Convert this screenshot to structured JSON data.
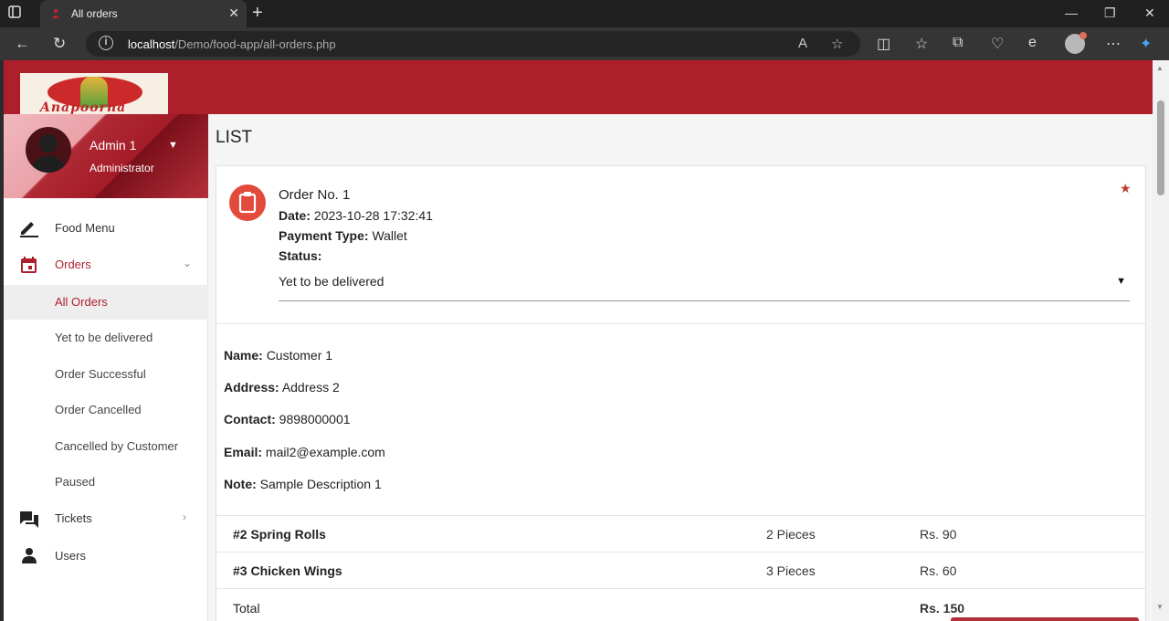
{
  "browser": {
    "tab_title": "All orders",
    "url_host": "localhost",
    "url_path": "/Demo/food-app/all-orders.php"
  },
  "brand": {
    "logo_text": "Anapoorna",
    "primary_color": "#ae1f2c",
    "accent_color": "#e24a3b"
  },
  "sidebar": {
    "user_name": "Admin 1",
    "user_role": "Administrator",
    "items": [
      {
        "label": "Food Menu",
        "icon": "pencil-icon"
      },
      {
        "label": "Orders",
        "icon": "calendar-icon"
      },
      {
        "label": "Tickets",
        "icon": "chat-icon"
      },
      {
        "label": "Users",
        "icon": "person-icon"
      }
    ],
    "order_subitems": [
      {
        "label": "All Orders",
        "active": true
      },
      {
        "label": "Yet to be delivered",
        "active": false
      },
      {
        "label": "Order Successful",
        "active": false
      },
      {
        "label": "Order Cancelled",
        "active": false
      },
      {
        "label": "Cancelled by Customer",
        "active": false
      },
      {
        "label": "Paused",
        "active": false
      }
    ]
  },
  "main": {
    "page_title": "LIST",
    "order": {
      "title": "Order No. 1",
      "date_label": "Date:",
      "date_value": "2023-10-28 17:32:41",
      "payment_label": "Payment Type:",
      "payment_value": "Wallet",
      "status_label": "Status:",
      "status_value": "Yet to be delivered",
      "customer": {
        "name_label": "Name:",
        "name_value": "Customer 1",
        "address_label": "Address:",
        "address_value": "Address 2",
        "contact_label": "Contact:",
        "contact_value": "9898000001",
        "email_label": "Email:",
        "email_value": "mail2@example.com",
        "note_label": "Note:",
        "note_value": "Sample Description 1"
      },
      "items": [
        {
          "name": "#2 Spring Rolls",
          "qty": "2 Pieces",
          "price": "Rs. 90"
        },
        {
          "name": "#3 Chicken Wings",
          "qty": "3 Pieces",
          "price": "Rs. 60"
        }
      ],
      "total_label": "Total",
      "total_value": "Rs. 150"
    }
  }
}
